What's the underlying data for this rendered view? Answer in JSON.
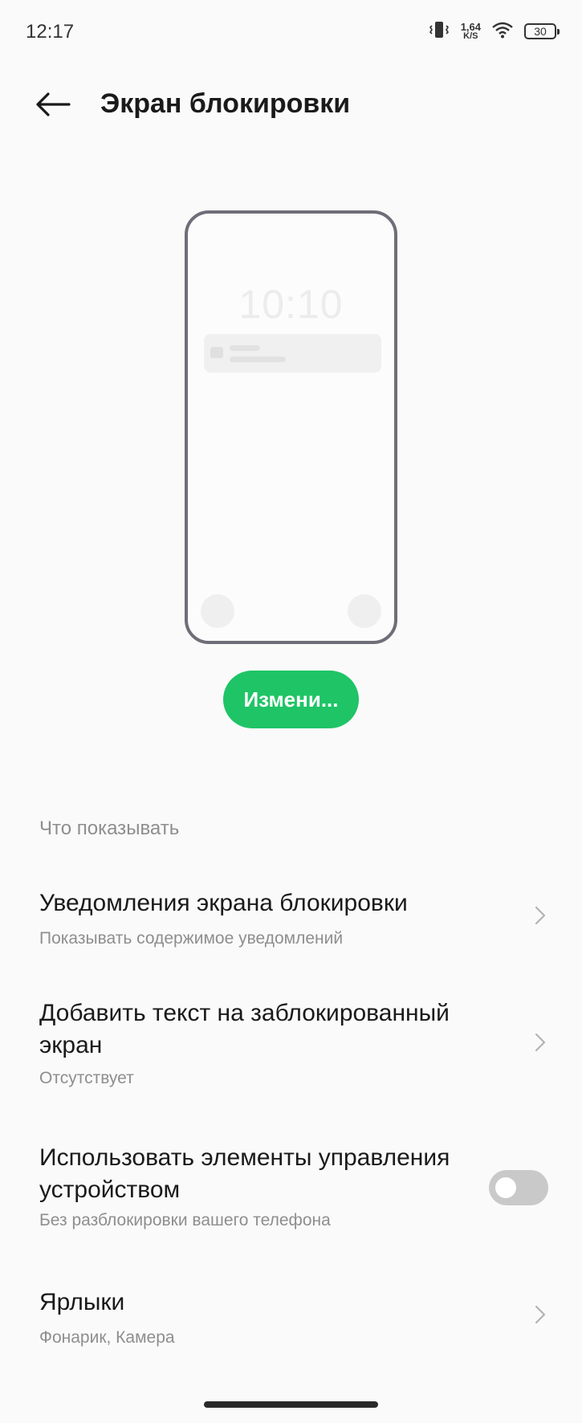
{
  "status_bar": {
    "time": "12:17",
    "net_speed_value": "1,64",
    "net_speed_unit": "K/S",
    "battery": "30"
  },
  "header": {
    "title": "Экран блокировки"
  },
  "preview": {
    "clock": "10:10"
  },
  "change_button": {
    "label": "Измени..."
  },
  "section": {
    "title": "Что показывать"
  },
  "settings": [
    {
      "title": "Уведомления экрана блокировки",
      "subtitle": "Показывать содержимое уведомлений",
      "control": "chevron"
    },
    {
      "title": "Добавить текст на заблокированный экран",
      "subtitle": "Отсутствует",
      "control": "chevron"
    },
    {
      "title": "Использовать элементы управления устройством",
      "subtitle": "Без разблокировки вашего телефона",
      "control": "toggle",
      "enabled": false
    },
    {
      "title": "Ярлыки",
      "subtitle": "Фонарик, Камера",
      "control": "chevron"
    }
  ],
  "colors": {
    "accent": "#1fc466",
    "toggle_off": "#c9c9c9",
    "secondary_text": "#8e8e8e"
  }
}
